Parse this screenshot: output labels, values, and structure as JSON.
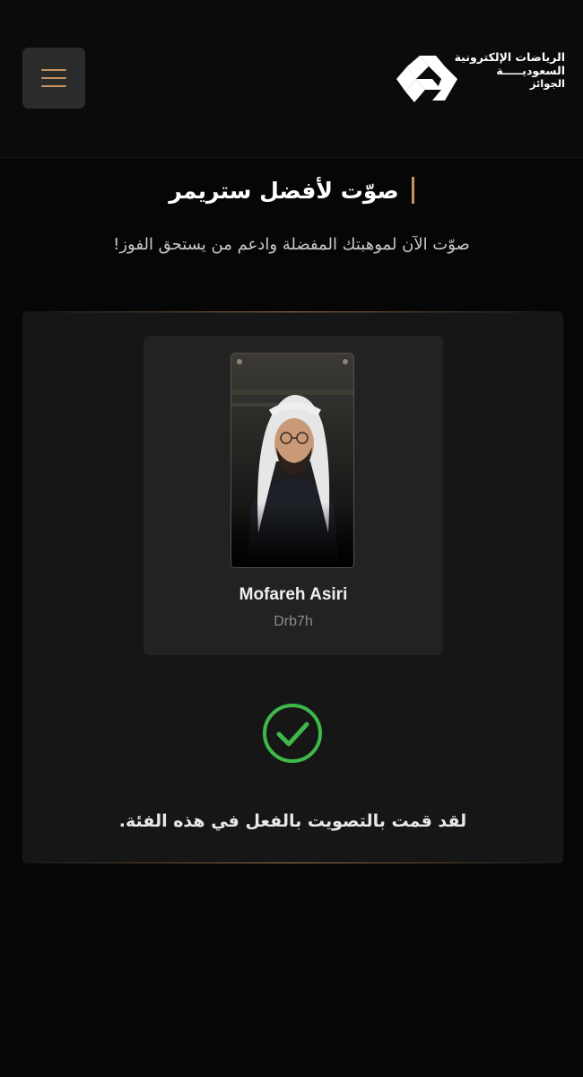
{
  "header": {
    "menu_icon": "hamburger-menu-icon",
    "logo": {
      "line1": "الرياضات الإلكترونية",
      "line2": "السعوديـــــة",
      "line3": "الجوائز"
    }
  },
  "page": {
    "title": "صوّت لأفضل ستريمر",
    "subtitle": "صوّت الآن لموهبتك المفضلة وادعم من يستحق الفوز!"
  },
  "nominee": {
    "name": "Mofareh Asiri",
    "handle": "Drb7h"
  },
  "status": {
    "icon": "check-circle-icon",
    "message": "لقد قمت بالتصويت بالفعل في هذه الفئة."
  },
  "colors": {
    "accent": "#c8915d",
    "success": "#3fb84a",
    "background": "#060606",
    "card": "#161616"
  }
}
